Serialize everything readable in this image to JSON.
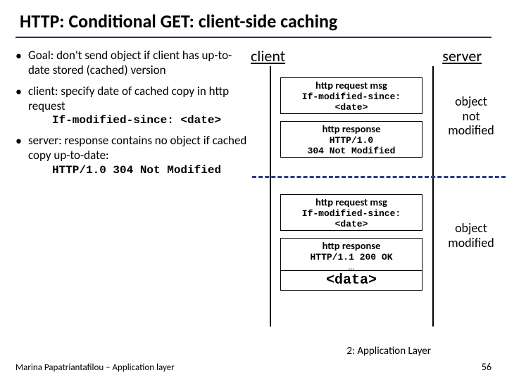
{
  "title": "HTTP: Conditional GET: client-side caching",
  "client_label": "client",
  "server_label": "server",
  "bullets": [
    {
      "text_a": "Goal: don't send object if client has up-to-date stored (cached) version"
    },
    {
      "text_a": "client: specify date of cached copy in http request",
      "code": "If-modified-since: <date>"
    },
    {
      "text_a": "server: response contains no object if cached copy up-to-date:",
      "code": "HTTP/1.0 304 Not Modified"
    }
  ],
  "exchange1": {
    "req_heading": "http request msg",
    "req_code1": "If-modified-since:",
    "req_code2": "<date>",
    "resp_heading": "http response",
    "resp_code1": "HTTP/1.0",
    "resp_code2": "304 Not Modified",
    "side": "object\nnot\nmodified"
  },
  "exchange2": {
    "req_heading": "http request msg",
    "req_code1": "If-modified-since:",
    "req_code2": "<date>",
    "resp_heading": "http response",
    "resp_code1": "HTTP/1.1 200 OK",
    "resp_dots": "…",
    "data": "<data>",
    "side": "object\nmodified"
  },
  "footer": {
    "left": "Marina Papatriantafilou – Application layer",
    "mid": "2: Application Layer",
    "num": "56"
  }
}
